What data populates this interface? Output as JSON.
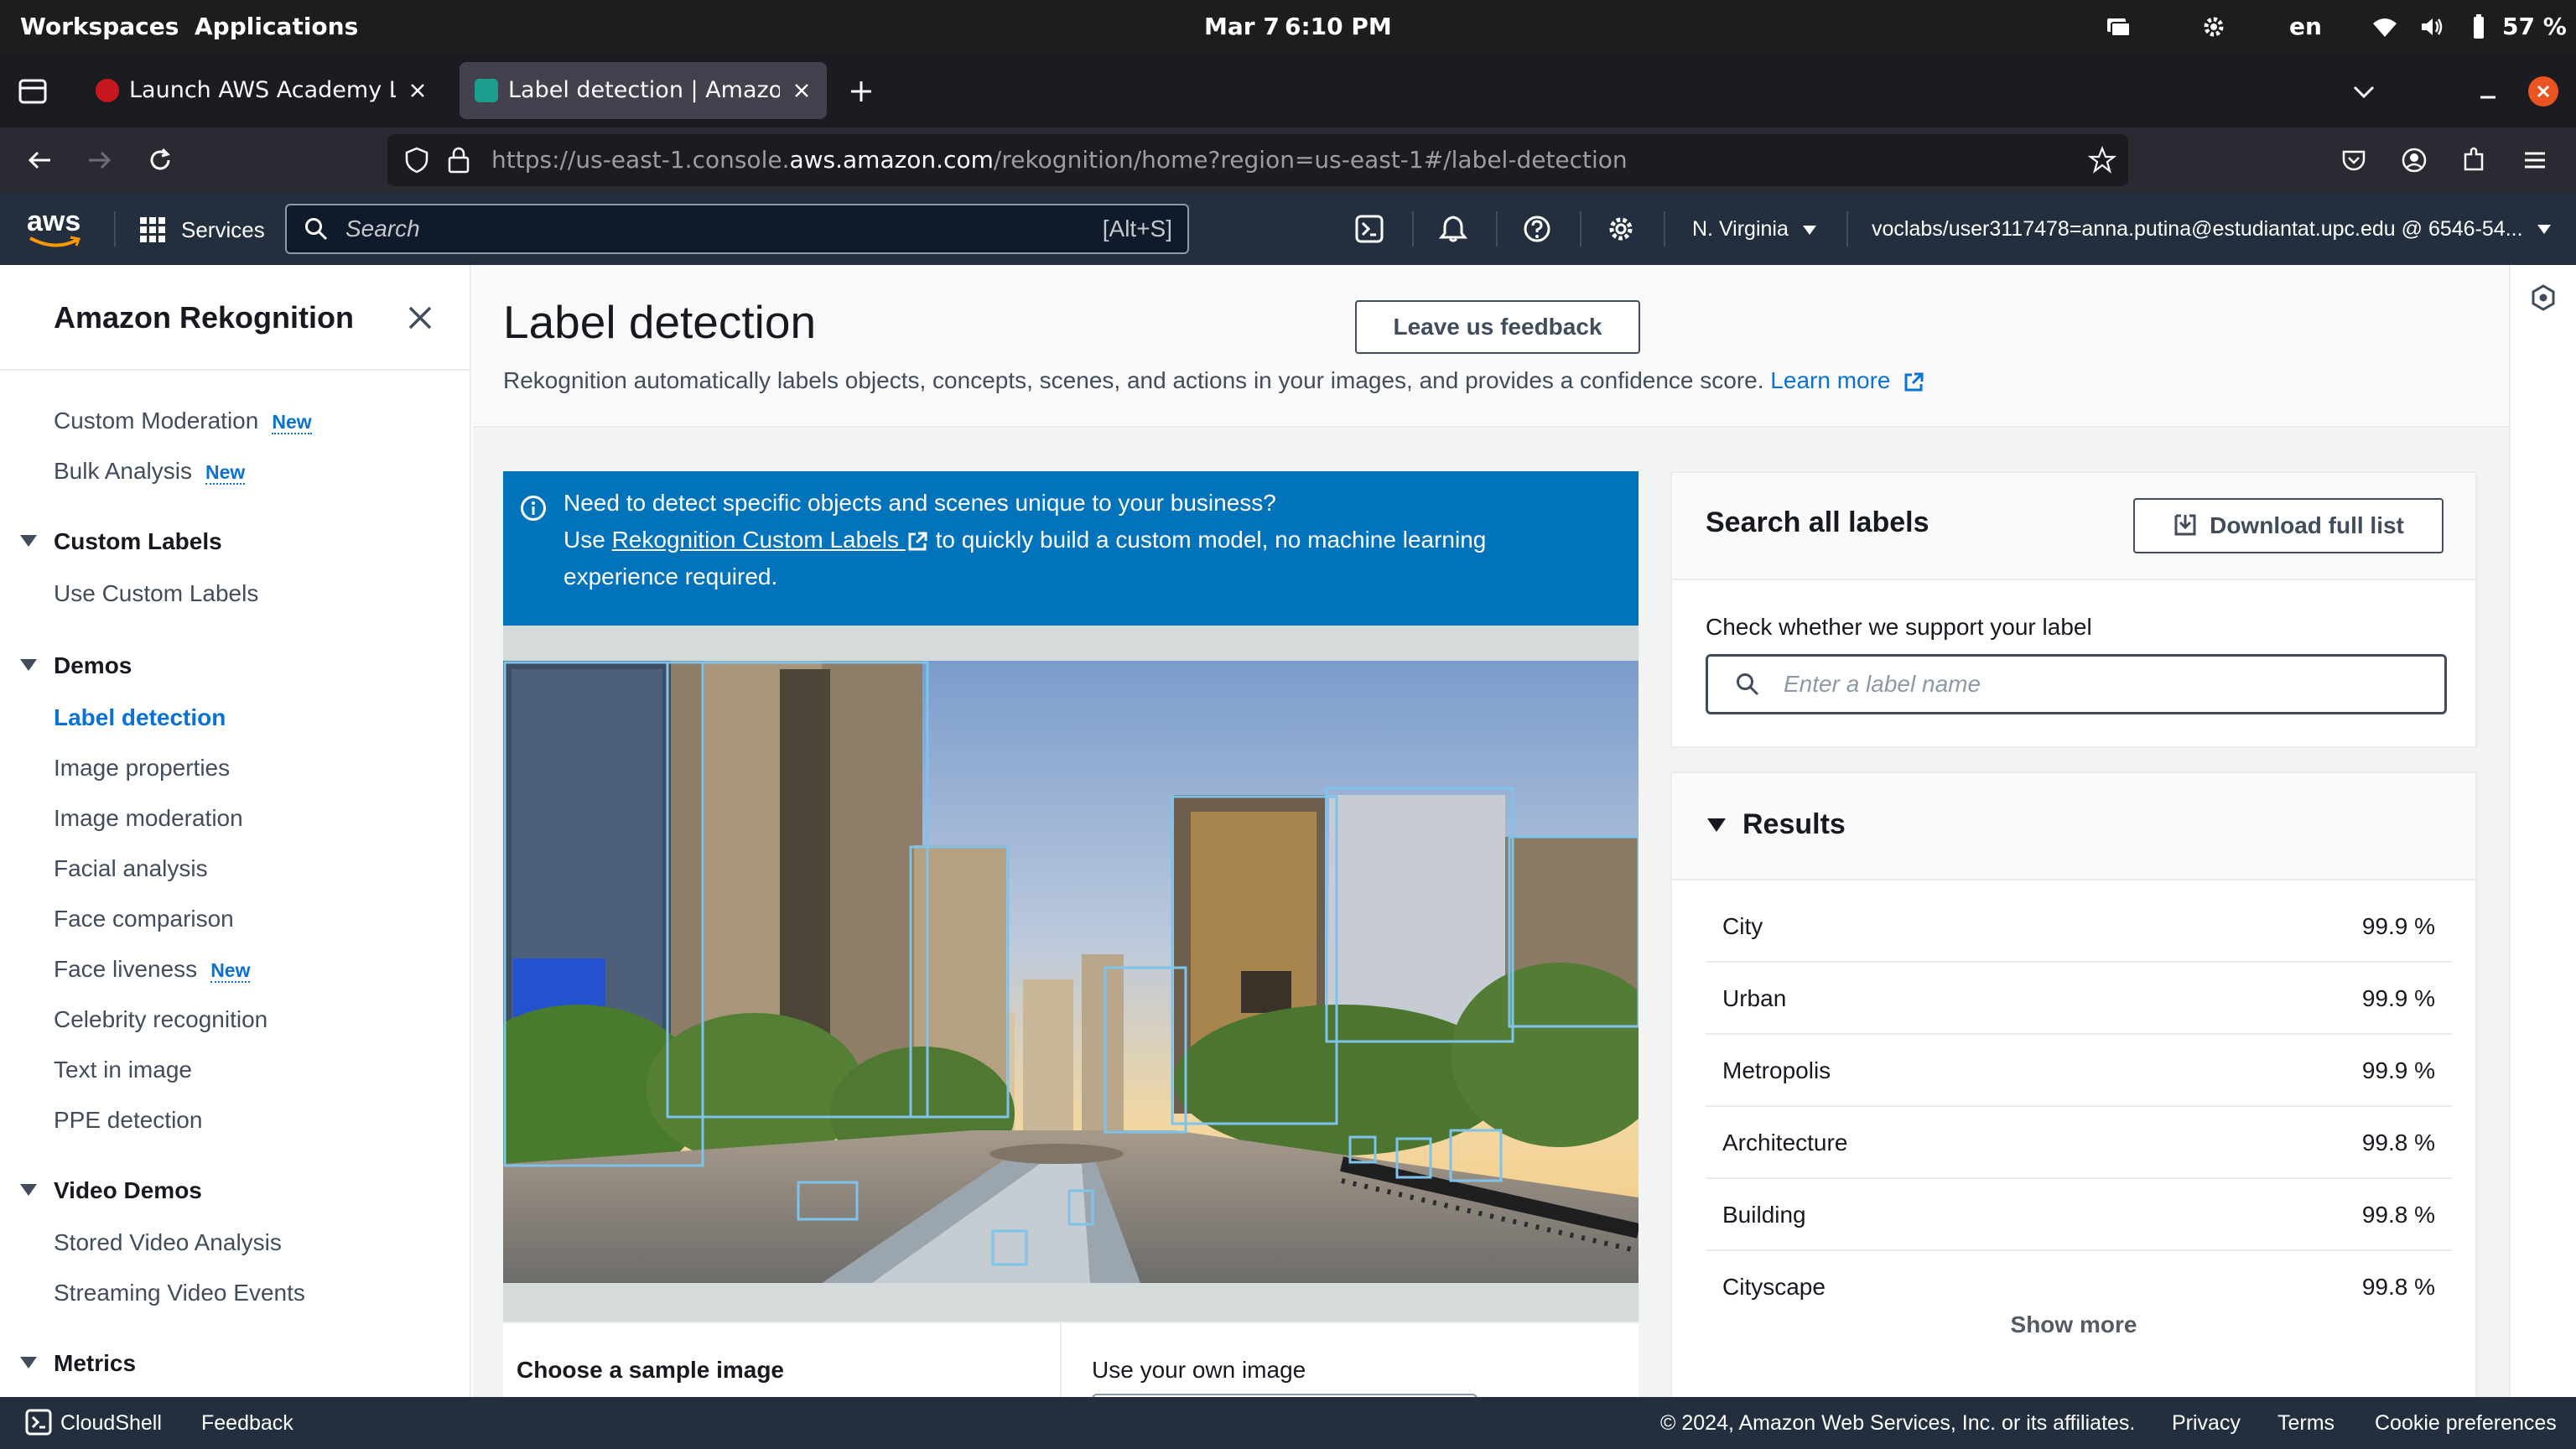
{
  "system": {
    "workspaces": "Workspaces",
    "applications": "Applications",
    "date": "Mar 7",
    "time": "6:10 PM",
    "language": "en",
    "battery": "57 %"
  },
  "browser": {
    "tabs": [
      {
        "label": "Launch AWS Academy Learr",
        "active": false,
        "favicon_color": "#c7161e"
      },
      {
        "label": "Label detection | Amazon R",
        "active": true,
        "favicon_color": "#1b9e8e"
      }
    ],
    "url_prefix": "https://us-east-1.console.",
    "url_domain": "aws.amazon.com",
    "url_path": "/rekognition/home?region=us-east-1#/label-detection"
  },
  "aws_header": {
    "logo": "aws",
    "services": "Services",
    "search_placeholder": "Search",
    "search_shortcut": "[Alt+S]",
    "region": "N. Virginia",
    "account": "voclabs/user3117478=anna.putina@estudiantat.upc.edu @ 6546-54..."
  },
  "sidenav": {
    "title": "Amazon Rekognition",
    "custom_moderation": "Custom Moderation",
    "bulk_analysis": "Bulk Analysis",
    "new_badge": "New",
    "custom_labels_section": "Custom Labels",
    "use_custom_labels": "Use Custom Labels",
    "demos_section": "Demos",
    "demos": {
      "label_detection": "Label detection",
      "image_properties": "Image properties",
      "image_moderation": "Image moderation",
      "facial_analysis": "Facial analysis",
      "face_comparison": "Face comparison",
      "face_liveness": "Face liveness",
      "celebrity_recognition": "Celebrity recognition",
      "text_in_image": "Text in image",
      "ppe_detection": "PPE detection"
    },
    "video_demos_section": "Video Demos",
    "stored_video": "Stored Video Analysis",
    "streaming_video": "Streaming Video Events",
    "metrics_section": "Metrics"
  },
  "page": {
    "title": "Label detection",
    "description": "Rekognition automatically labels objects, concepts, scenes, and actions in your images, and provides a confidence score.",
    "learn_more": "Learn more",
    "feedback_button": "Leave us feedback"
  },
  "info": {
    "line1": "Need to detect specific objects and scenes unique to your business?",
    "line2_pre": "Use",
    "line2_link": "Rekognition Custom Labels",
    "line2_post": "to quickly build a custom model, no machine learning",
    "line3": "experience required."
  },
  "search_labels": {
    "title": "Search all labels",
    "download": "Download full list",
    "check_label": "Check whether we support your label",
    "placeholder": "Enter a label name"
  },
  "results": {
    "title": "Results",
    "rows": [
      {
        "label": "City",
        "confidence": "99.9 %"
      },
      {
        "label": "Urban",
        "confidence": "99.9 %"
      },
      {
        "label": "Metropolis",
        "confidence": "99.9 %"
      },
      {
        "label": "Architecture",
        "confidence": "99.8 %"
      },
      {
        "label": "Building",
        "confidence": "99.8 %"
      },
      {
        "label": "Cityscape",
        "confidence": "99.8 %"
      }
    ],
    "show_more": "Show more"
  },
  "sample": {
    "choose_sample": "Choose a sample image",
    "use_own": "Use your own image"
  },
  "footer": {
    "cloudshell": "CloudShell",
    "feedback": "Feedback",
    "copyright": "© 2024, Amazon Web Services, Inc. or its affiliates.",
    "privacy": "Privacy",
    "terms": "Terms",
    "cookies": "Cookie preferences"
  },
  "colors": {
    "aws_nav": "#232f3e",
    "link_blue": "#0972d3",
    "info_blue": "#0073bb",
    "aws_orange": "#ff9900"
  }
}
